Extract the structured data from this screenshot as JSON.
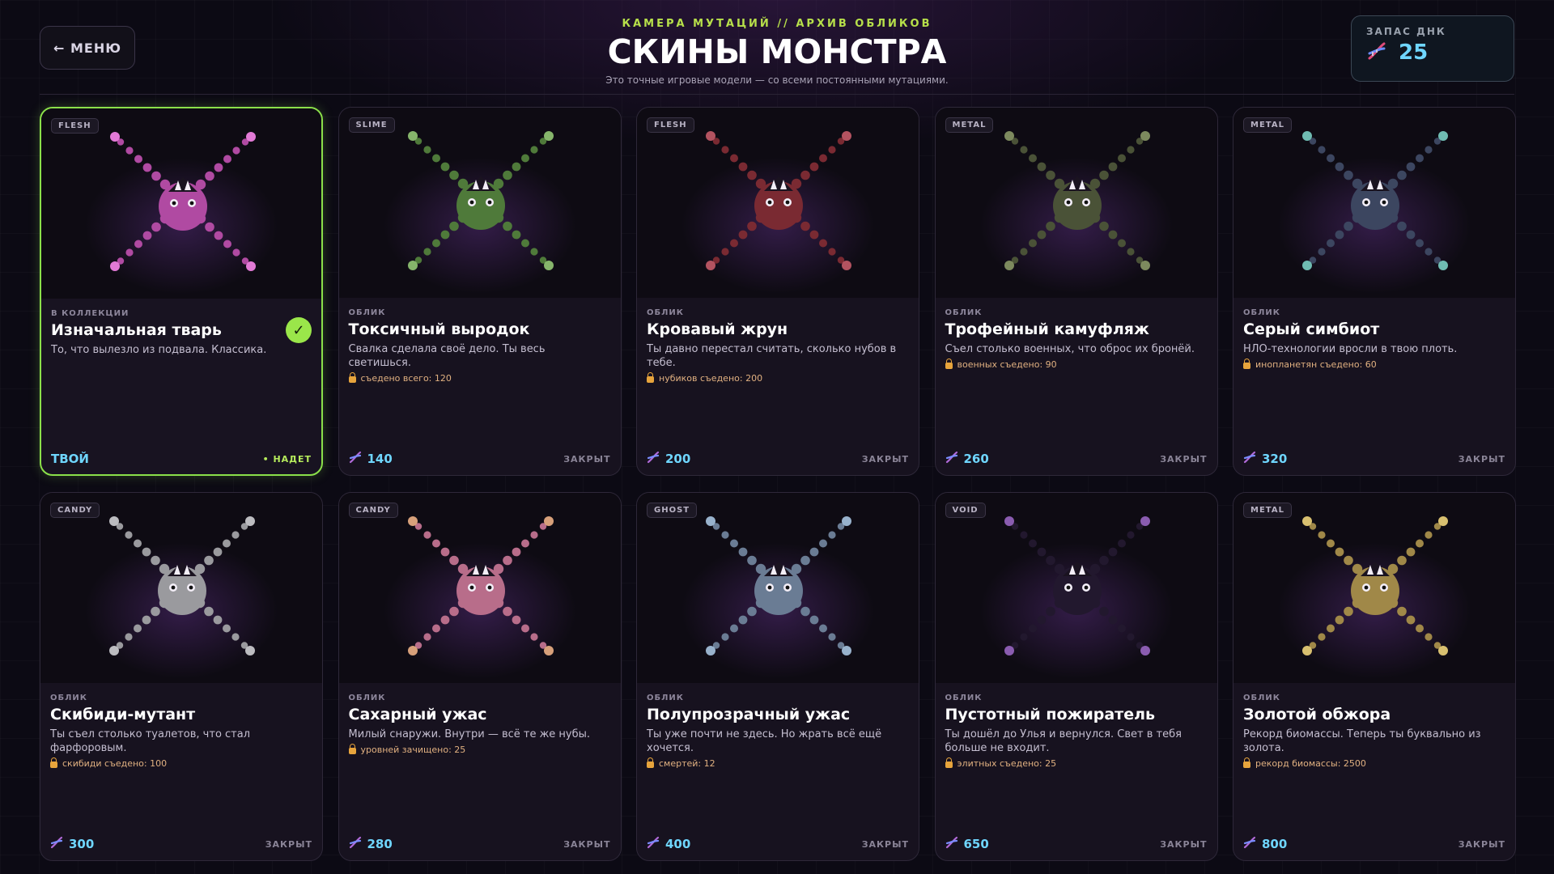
{
  "menu": {
    "label": "← МЕНЮ"
  },
  "header": {
    "eyebrow": "КАМЕРА МУТАЦИЙ // АРХИВ ОБЛИКОВ",
    "title": "СКИНЫ МОНСТРА",
    "subtitle": "Это точные игровые модели — со всеми постоянными мутациями."
  },
  "dna": {
    "label": "ЗАПАС ДНК",
    "value": "25",
    "icon": "dna-icon"
  },
  "cards": [
    {
      "tag": "FLESH",
      "kind": "В КОЛЛЕКЦИИ",
      "name": "Изначальная тварь",
      "desc": "То, что вылезло из подвала. Классика.",
      "req": "",
      "price": "",
      "status": "",
      "owned": true,
      "owned_label": "ТВОЙ",
      "equipped_label": "• НАДЕТ",
      "color": "#b04aa2",
      "tip": "#e27ad6"
    },
    {
      "tag": "SLIME",
      "kind": "ОБЛИК",
      "name": "Токсичный выродок",
      "desc": "Свалка сделала своё дело. Ты весь светишься.",
      "req": "съедено всего: 120",
      "price": "140",
      "status": "ЗАКРЫТ",
      "color": "#4f7a3a",
      "tip": "#86b56b"
    },
    {
      "tag": "FLESH",
      "kind": "ОБЛИК",
      "name": "Кровавый жрун",
      "desc": "Ты давно перестал считать, сколько нубов в тебе.",
      "req": "нубиков съедено: 200",
      "price": "200",
      "status": "ЗАКРЫТ",
      "color": "#7a2a32",
      "tip": "#b35360"
    },
    {
      "tag": "METAL",
      "kind": "ОБЛИК",
      "name": "Трофейный камуфляж",
      "desc": "Съел столько военных, что оброс их бронёй.",
      "req": "военных съедено: 90",
      "price": "260",
      "status": "ЗАКРЫТ",
      "color": "#4a5237",
      "tip": "#7d8a5e"
    },
    {
      "tag": "METAL",
      "kind": "ОБЛИК",
      "name": "Серый симбиот",
      "desc": "НЛО-технологии вросли в твою плоть.",
      "req": "инопланетян съедено: 60",
      "price": "320",
      "status": "ЗАКРЫТ",
      "color": "#3c4660",
      "tip": "#6fbcb2"
    },
    {
      "tag": "CANDY",
      "kind": "ОБЛИК",
      "name": "Скибиди-мутант",
      "desc": "Ты съел столько туалетов, что стал фарфоровым.",
      "req": "скибиди съедено: 100",
      "price": "300",
      "status": "ЗАКРЫТ",
      "color": "#9a9a9e",
      "tip": "#bcbcc0"
    },
    {
      "tag": "CANDY",
      "kind": "ОБЛИК",
      "name": "Сахарный ужас",
      "desc": "Милый снаружи. Внутри — всё те же нубы.",
      "req": "уровней зачищено: 25",
      "price": "280",
      "status": "ЗАКРЫТ",
      "color": "#b86d8a",
      "tip": "#d7a07a"
    },
    {
      "tag": "GHOST",
      "kind": "ОБЛИК",
      "name": "Полупрозрачный ужас",
      "desc": "Ты уже почти не здесь. Но жрать всё ещё хочется.",
      "req": "смертей: 12",
      "price": "400",
      "status": "ЗАКРЫТ",
      "color": "#6a7c94",
      "tip": "#98b2cc"
    },
    {
      "tag": "VOID",
      "kind": "ОБЛИК",
      "name": "Пустотный пожиратель",
      "desc": "Ты дошёл до Улья и вернулся. Свет в тебя больше не входит.",
      "req": "элитных съедено: 25",
      "price": "650",
      "status": "ЗАКРЫТ",
      "color": "#22182e",
      "tip": "#8a5cb0"
    },
    {
      "tag": "METAL",
      "kind": "ОБЛИК",
      "name": "Золотой обжора",
      "desc": "Рекорд биомассы. Теперь ты буквально из золота.",
      "req": "рекорд биомассы: 2500",
      "price": "800",
      "status": "ЗАКРЫТ",
      "color": "#a08848",
      "tip": "#d8c070"
    }
  ]
}
